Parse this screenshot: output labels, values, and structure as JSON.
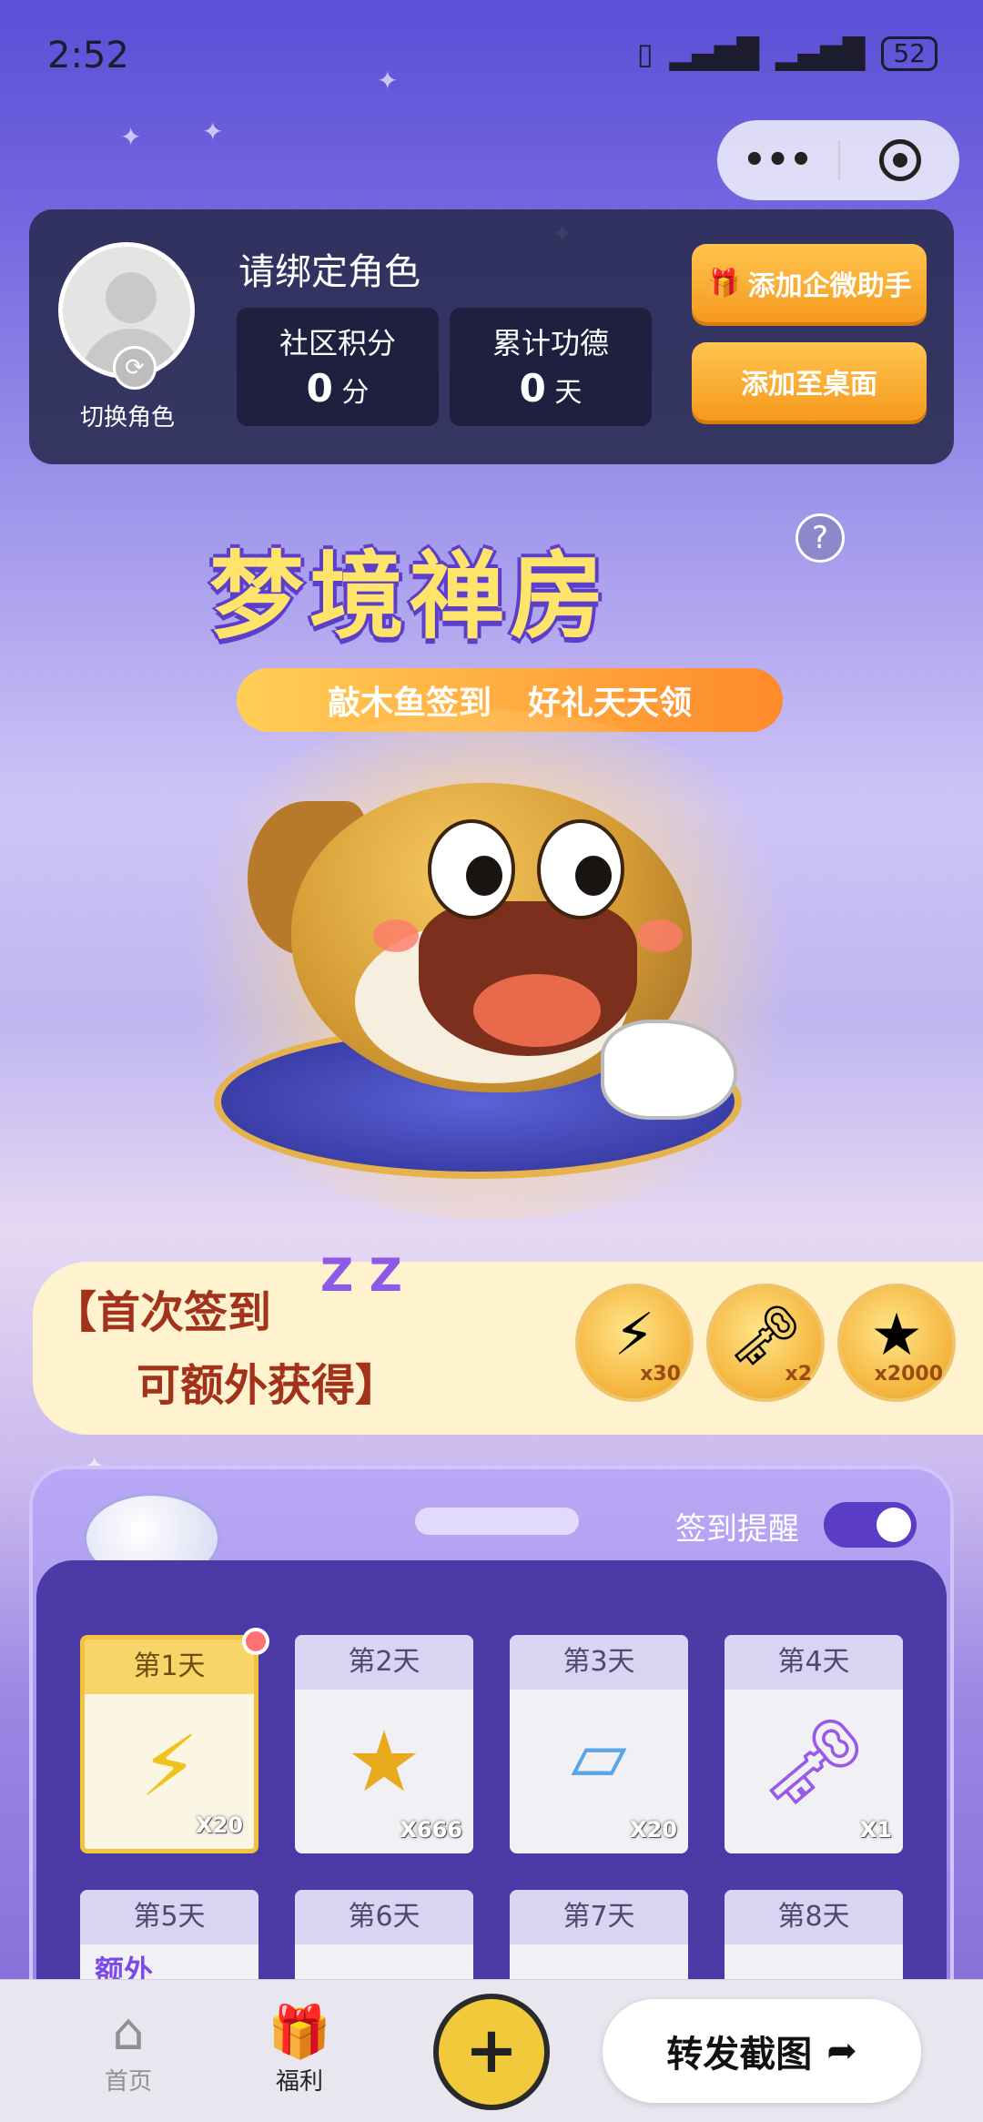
{
  "status_bar": {
    "time": "2:52",
    "battery": "52"
  },
  "profile": {
    "bind_prompt": "请绑定角色",
    "switch_label": "切换角色",
    "stats": [
      {
        "label": "社区积分",
        "value": "0",
        "unit": "分"
      },
      {
        "label": "累计功德",
        "value": "0",
        "unit": "天"
      }
    ],
    "buttons": {
      "add_assistant": "添加企微助手",
      "add_to_desktop": "添加至桌面"
    }
  },
  "banner": {
    "title": "梦境禅房",
    "subtitle_left": "敲木鱼签到",
    "subtitle_right": "好礼天天领",
    "help": "?"
  },
  "first_signin": {
    "line1": "【首次签到",
    "line2": "可额外获得】",
    "zz": "Z Z",
    "rewards": [
      {
        "icon": "lightning-icon",
        "count": "x30"
      },
      {
        "icon": "key-icon",
        "count": "x2"
      },
      {
        "icon": "coin-icon",
        "count": "x2000"
      }
    ]
  },
  "signin_panel": {
    "reminder_label": "签到提醒",
    "reminder_on": true,
    "days": [
      {
        "label": "第1天",
        "icon": "lightning-icon",
        "count": "X20",
        "active": true
      },
      {
        "label": "第2天",
        "icon": "coin-icon",
        "count": "X666"
      },
      {
        "label": "第3天",
        "icon": "map-icon",
        "count": "X20"
      },
      {
        "label": "第4天",
        "icon": "key-icon",
        "count": "X1"
      },
      {
        "label": "第5天",
        "extra": "额外"
      },
      {
        "label": "第6天"
      },
      {
        "label": "第7天"
      },
      {
        "label": "第8天"
      }
    ]
  },
  "bottom_nav": {
    "home": "首页",
    "welfare": "福利",
    "plus": "+",
    "share": "转发截图"
  }
}
